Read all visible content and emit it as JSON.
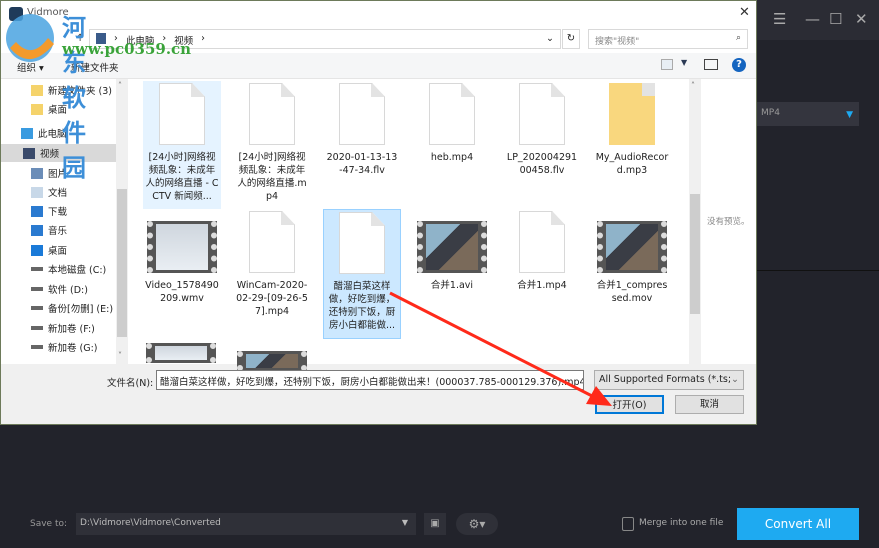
{
  "dialog": {
    "title": "Vidmore",
    "close": "✕",
    "breadcrumb": [
      "此电脑",
      "视频"
    ],
    "search_placeholder": "搜索\"视频\"",
    "toolbar": {
      "organize": "组织 ▾",
      "new_folder": "新建文件夹"
    },
    "sidebar": [
      {
        "label": "新建文件夹 (3)",
        "icon": "folder-icon"
      },
      {
        "label": "桌面",
        "icon": "folder-icon"
      },
      {
        "label": "此电脑",
        "icon": "computer-icon"
      },
      {
        "label": "视频",
        "icon": "video-icon",
        "selected": true
      },
      {
        "label": "图片",
        "icon": "picture-icon"
      },
      {
        "label": "文档",
        "icon": "document-icon"
      },
      {
        "label": "下载",
        "icon": "download-icon"
      },
      {
        "label": "音乐",
        "icon": "music-icon"
      },
      {
        "label": "桌面",
        "icon": "desktop-icon"
      },
      {
        "label": "本地磁盘 (C:)",
        "icon": "drive-icon"
      },
      {
        "label": "软件 (D:)",
        "icon": "drive-icon"
      },
      {
        "label": "备份[勿删] (E:)",
        "icon": "drive-icon"
      },
      {
        "label": "新加卷 (F:)",
        "icon": "drive-icon"
      },
      {
        "label": "新加卷 (G:)",
        "icon": "drive-icon"
      }
    ],
    "files": [
      {
        "name": "[24小时]网络视频乱象：未成年人的网络直播 - CCTV 新闻频...",
        "type": "doc",
        "state": "hover"
      },
      {
        "name": "[24小时]网络视频乱象：未成年人的网络直播.mp4",
        "type": "doc"
      },
      {
        "name": "2020-01-13-13-47-34.flv",
        "type": "doc"
      },
      {
        "name": "heb.mp4",
        "type": "doc"
      },
      {
        "name": "LP_20200429100458.flv",
        "type": "doc"
      },
      {
        "name": "My_AudioRecord.mp3",
        "type": "folder"
      },
      {
        "name": "Video_1578490209.wmv",
        "type": "film-wmv"
      },
      {
        "name": "WinCam-2020-02-29-[09-26-57].mp4",
        "type": "doc"
      },
      {
        "name": "醋溜白菜这样做，好吃到爆，还特别下饭，厨房小白都能做...",
        "type": "doc",
        "state": "selected"
      },
      {
        "name": "合并1.avi",
        "type": "film"
      },
      {
        "name": "合并1.mp4",
        "type": "doc"
      },
      {
        "name": "合并1_compressed.mov",
        "type": "film"
      }
    ],
    "preview_text": "没有预览。",
    "filename_label": "文件名(N):",
    "filename_value": "醋溜白菜这样做，好吃到爆，还特别下饭，厨房小白都能做出来！(000037.785-000129.376).mp4",
    "filter": "All Supported Formats (*.ts;",
    "open": "打开(O)",
    "cancel": "取消"
  },
  "app": {
    "format": "MP4",
    "save_to_label": "Save to:",
    "save_path": "D:\\Vidmore\\Vidmore\\Converted",
    "merge_label": "Merge into one file",
    "merge_checked": false,
    "convert_all": "Convert All",
    "accent": "#1eaaf1"
  },
  "watermark": {
    "name": "河东软件园",
    "url": "www.pc0359.cn"
  },
  "annotation": {
    "arrow_color": "#ff2a1a"
  }
}
